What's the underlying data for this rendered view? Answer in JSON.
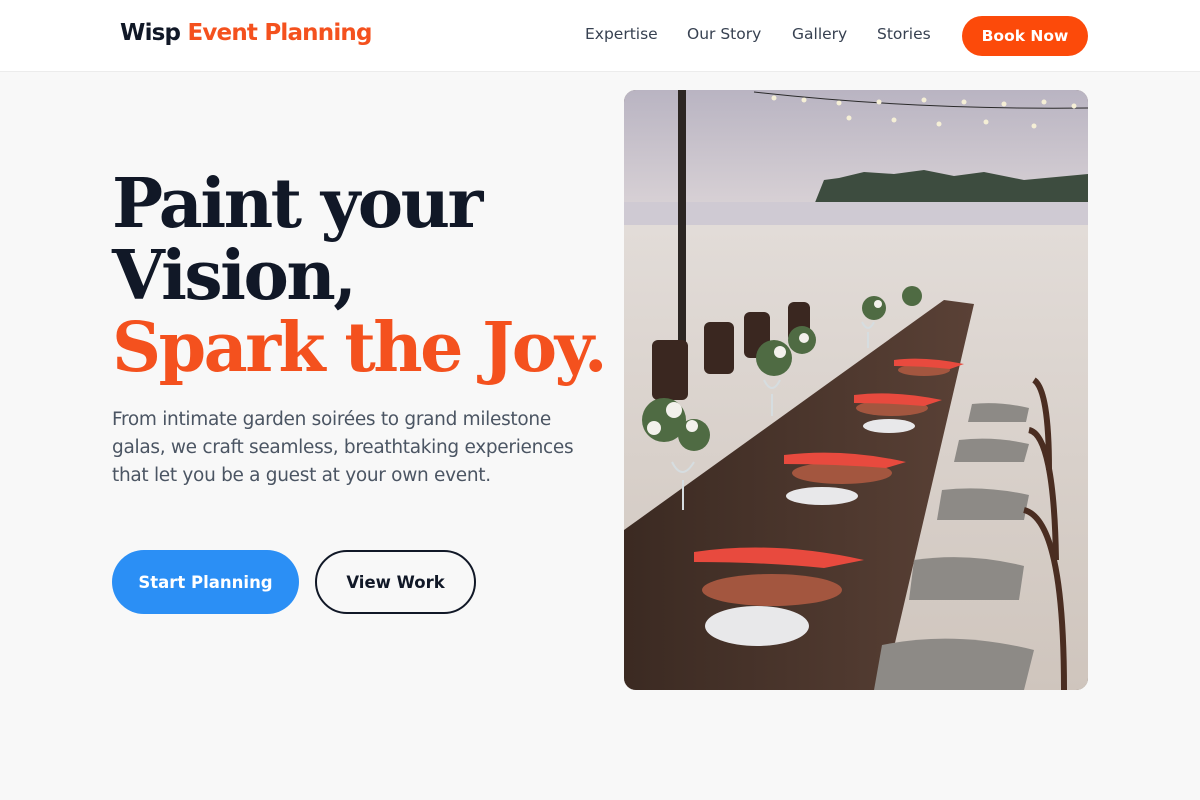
{
  "header": {
    "logo": {
      "part1": "Wisp",
      "part2": "Event Planning"
    },
    "nav": [
      {
        "label": "Expertise"
      },
      {
        "label": "Our Story"
      },
      {
        "label": "Gallery"
      },
      {
        "label": "Stories"
      }
    ],
    "cta_label": "Book Now"
  },
  "hero": {
    "headline": {
      "line1": "Paint your",
      "line2": "Vision,",
      "line3": "Spark the Joy."
    },
    "subtitle": "From intimate garden soirées to grand milestone galas, we craft seamless, breathtaking experiences that let you be a guest at your own event.",
    "primary_button": "Start Planning",
    "secondary_button": "View Work",
    "image_subject": "beach-dinner-table-setting"
  },
  "colors": {
    "accent": "#f4511e",
    "cta": "#fc4a0a",
    "primary_button": "#2b8ff5",
    "text_dark": "#111827",
    "text_muted": "#4b5563",
    "background": "#f8f8f8"
  }
}
